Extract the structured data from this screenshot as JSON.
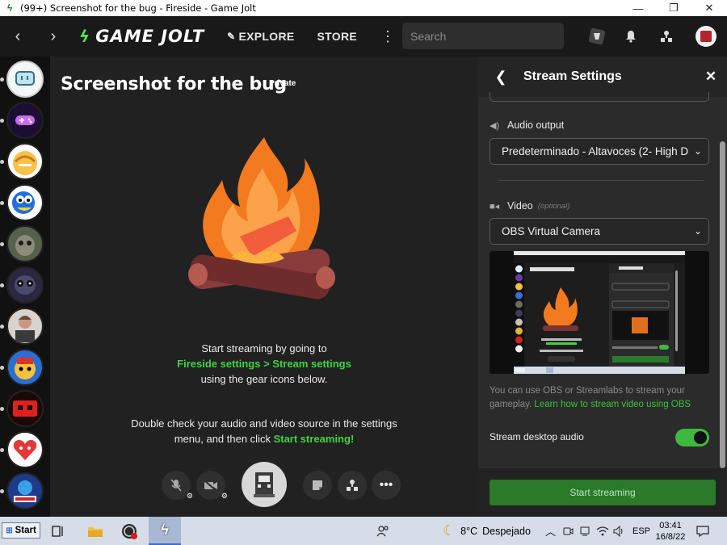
{
  "window": {
    "title": "(99+) Screenshot for the bug - Fireside - Game Jolt",
    "minimize": "—",
    "restore": "❐",
    "close": "✕"
  },
  "nav": {
    "back": "‹",
    "forward": "›",
    "logo": "GAME JOLT",
    "explore": "EXPLORE",
    "store": "STORE",
    "more": "⋮",
    "search_placeholder": "Search"
  },
  "fireside": {
    "title": "Screenshot for the bug",
    "badge": "Private",
    "hint1_line1": "Start streaming by going to",
    "hint1_link": "Fireside settings > Stream settings",
    "hint1_line3": "using the gear icons below.",
    "hint2_line1": "Double check your audio and video source in the settings",
    "hint2_line2": "menu, and then click ",
    "hint2_link": "Start streaming!"
  },
  "stream_settings": {
    "title": "Stream Settings",
    "audio_output_label": "Audio output",
    "audio_output_value": "Predeterminado - Altavoces (2- High D",
    "video_label": "Video",
    "video_optional": "(optional)",
    "video_value": "OBS Virtual Camera",
    "note_text": "You can use OBS or Streamlabs to stream your gameplay. ",
    "note_link": "Learn how to stream video using OBS",
    "desktop_audio_label": "Stream desktop audio",
    "desktop_audio_on": true,
    "start_button": "Start streaming"
  },
  "taskbar": {
    "start": "Start",
    "weather_temp": "8°C",
    "weather_text": "Despejado",
    "language": "ESP",
    "time": "03:41",
    "date": "16/8/22"
  },
  "colors": {
    "accent_green": "#3fd43f",
    "toggle_green": "#3fb83f",
    "button_green": "#2a7a2a"
  }
}
